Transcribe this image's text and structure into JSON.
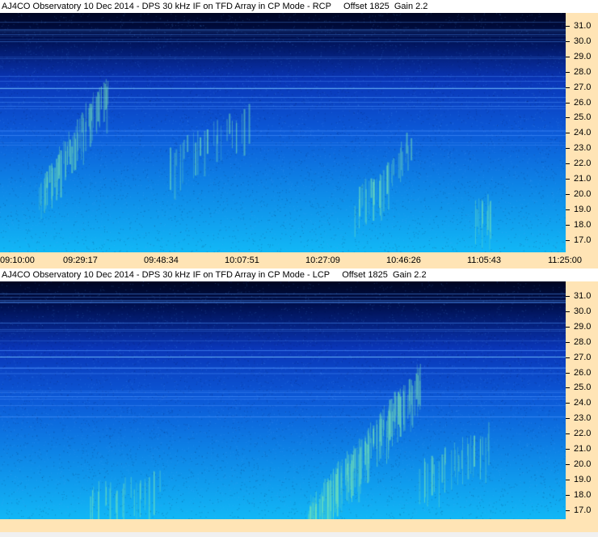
{
  "rcp": {
    "title": "AJ4CO Observatory 10 Dec 2014 - DPS 30 kHz IF on TFD Array in CP Mode - RCP     Offset 1825  Gain 2.2",
    "freq_labels": [
      "31.0",
      "30.0",
      "29.0",
      "28.0",
      "27.0",
      "26.0",
      "25.0",
      "24.0",
      "23.0",
      "22.0",
      "21.0",
      "20.0",
      "19.0",
      "18.0",
      "17.0"
    ],
    "time_labels": [
      "09:10:00",
      "09:29:17",
      "09:48:34",
      "10:07:51",
      "10:27:09",
      "10:46:26",
      "11:05:43",
      "11:25:00"
    ]
  },
  "lcp": {
    "title": "AJ4CO Observatory 10 Dec 2014 - DPS 30 kHz IF on TFD Array in CP Mode - LCP     Offset 1825  Gain 2.2",
    "freq_labels": [
      "31.0",
      "30.0",
      "29.0",
      "28.0",
      "27.0",
      "26.0",
      "25.0",
      "24.0",
      "23.0",
      "22.0",
      "21.0",
      "20.0",
      "19.0",
      "18.0",
      "17.0"
    ]
  },
  "colors": {
    "axis_bg": "#ffe4b5",
    "spectro_dark": "#000833",
    "spectro_light": "#10b8f8",
    "burst": "#9cf060"
  }
}
